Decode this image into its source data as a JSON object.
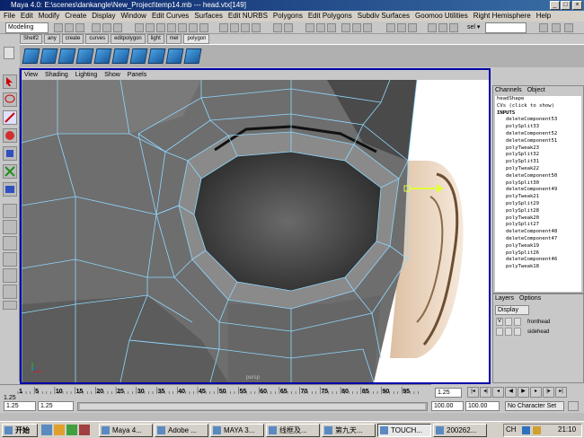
{
  "window": {
    "title": "Maya 4.0: E:\\scenes\\dankangle\\New_Project\\temp14.mb  ---  head.vtx[149]"
  },
  "menubar": [
    "File",
    "Edit",
    "Modify",
    "Create",
    "Display",
    "Window",
    "Edit Curves",
    "Surfaces",
    "Edit NURBS",
    "Polygons",
    "Edit Polygons",
    "Subdiv Surfaces",
    "Goomoo Utilities",
    "Right Hemisphere",
    "Help"
  ],
  "statusline": {
    "mode": "Modeling",
    "sel_label": "sel ▾"
  },
  "shelf": {
    "tabs": [
      "Shelf2",
      "any",
      "create",
      "curves",
      "editpolygon",
      "light",
      "mel",
      "polygon"
    ],
    "active": "polygon"
  },
  "viewport": {
    "menu": [
      "View",
      "Shading",
      "Lighting",
      "Show",
      "Panels"
    ],
    "mesh_color": "#8fd8ff",
    "bg_color": "#ffffff",
    "label": "persp"
  },
  "channel_box": {
    "tabs": [
      "Channels",
      "Object"
    ],
    "shape": "headShape",
    "cvs": "CVs (click to show)",
    "inputs_label": "INPUTS",
    "inputs": [
      "deleteComponent53",
      "polySplit33",
      "deleteComponent52",
      "deleteComponent51",
      "polyTweak23",
      "polySplit32",
      "polySplit31",
      "polyTweak22",
      "deleteComponent50",
      "polySplit30",
      "deleteComponent49",
      "polyTweak21",
      "polySplit29",
      "polySplit28",
      "polyTweak20",
      "polySplit27",
      "deleteComponent48",
      "deleteComponent47",
      "polyTweak19",
      "polySplit26",
      "deleteComponent46",
      "polyTweak18"
    ]
  },
  "layers": {
    "tabs": [
      "Layers",
      "Options"
    ],
    "dropdown": "Display",
    "items": [
      {
        "vis": "V",
        "name": "fronthead"
      },
      {
        "vis": "",
        "name": "sidehead"
      }
    ]
  },
  "timeline": {
    "ticks": [
      "1",
      "5",
      "10",
      "15",
      "20",
      "25",
      "30",
      "35",
      "40",
      "45",
      "50",
      "55",
      "60",
      "65",
      "70",
      "75",
      "80",
      "85",
      "90",
      "95"
    ],
    "current": "1.25",
    "current_frame": "1.25",
    "marker": "1.25"
  },
  "range": {
    "start": "1.25",
    "start2": "1.25",
    "end": "100.00",
    "end2": "100.00",
    "char_set": "No Character Set"
  },
  "taskbar": {
    "start": "开始",
    "buttons": [
      "Maya 4...",
      "Adobe ...",
      "MAYA 3...",
      "线框及...",
      "第九天...",
      "TOUCH...",
      "200262..."
    ],
    "pressed": "TOUCH...",
    "lang": "CH",
    "clock": "21:10"
  }
}
